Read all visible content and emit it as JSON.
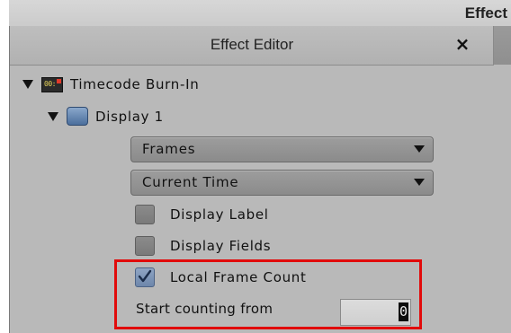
{
  "window": {
    "title": "Effect"
  },
  "panel": {
    "title": "Effect Editor",
    "close_glyph": "×"
  },
  "tree": {
    "effect": {
      "label": "Timecode Burn-In",
      "icon": "timecode-effect-icon",
      "icon_text": "00:"
    },
    "group": {
      "label": "Display 1",
      "icon": "display-group-icon"
    }
  },
  "controls": {
    "dropdown1": {
      "value": "Frames"
    },
    "dropdown2": {
      "value": "Current Time"
    },
    "checkbox_display_label": {
      "label": "Display Label",
      "checked": false
    },
    "checkbox_display_fields": {
      "label": "Display Fields",
      "checked": false
    },
    "checkbox_local_frame_count": {
      "label": "Local Frame Count",
      "checked": true
    },
    "start_counting": {
      "label": "Start counting from",
      "value": "0"
    }
  },
  "colors": {
    "highlight": "#e10b0b",
    "panel_bg": "#b9b9b9"
  }
}
